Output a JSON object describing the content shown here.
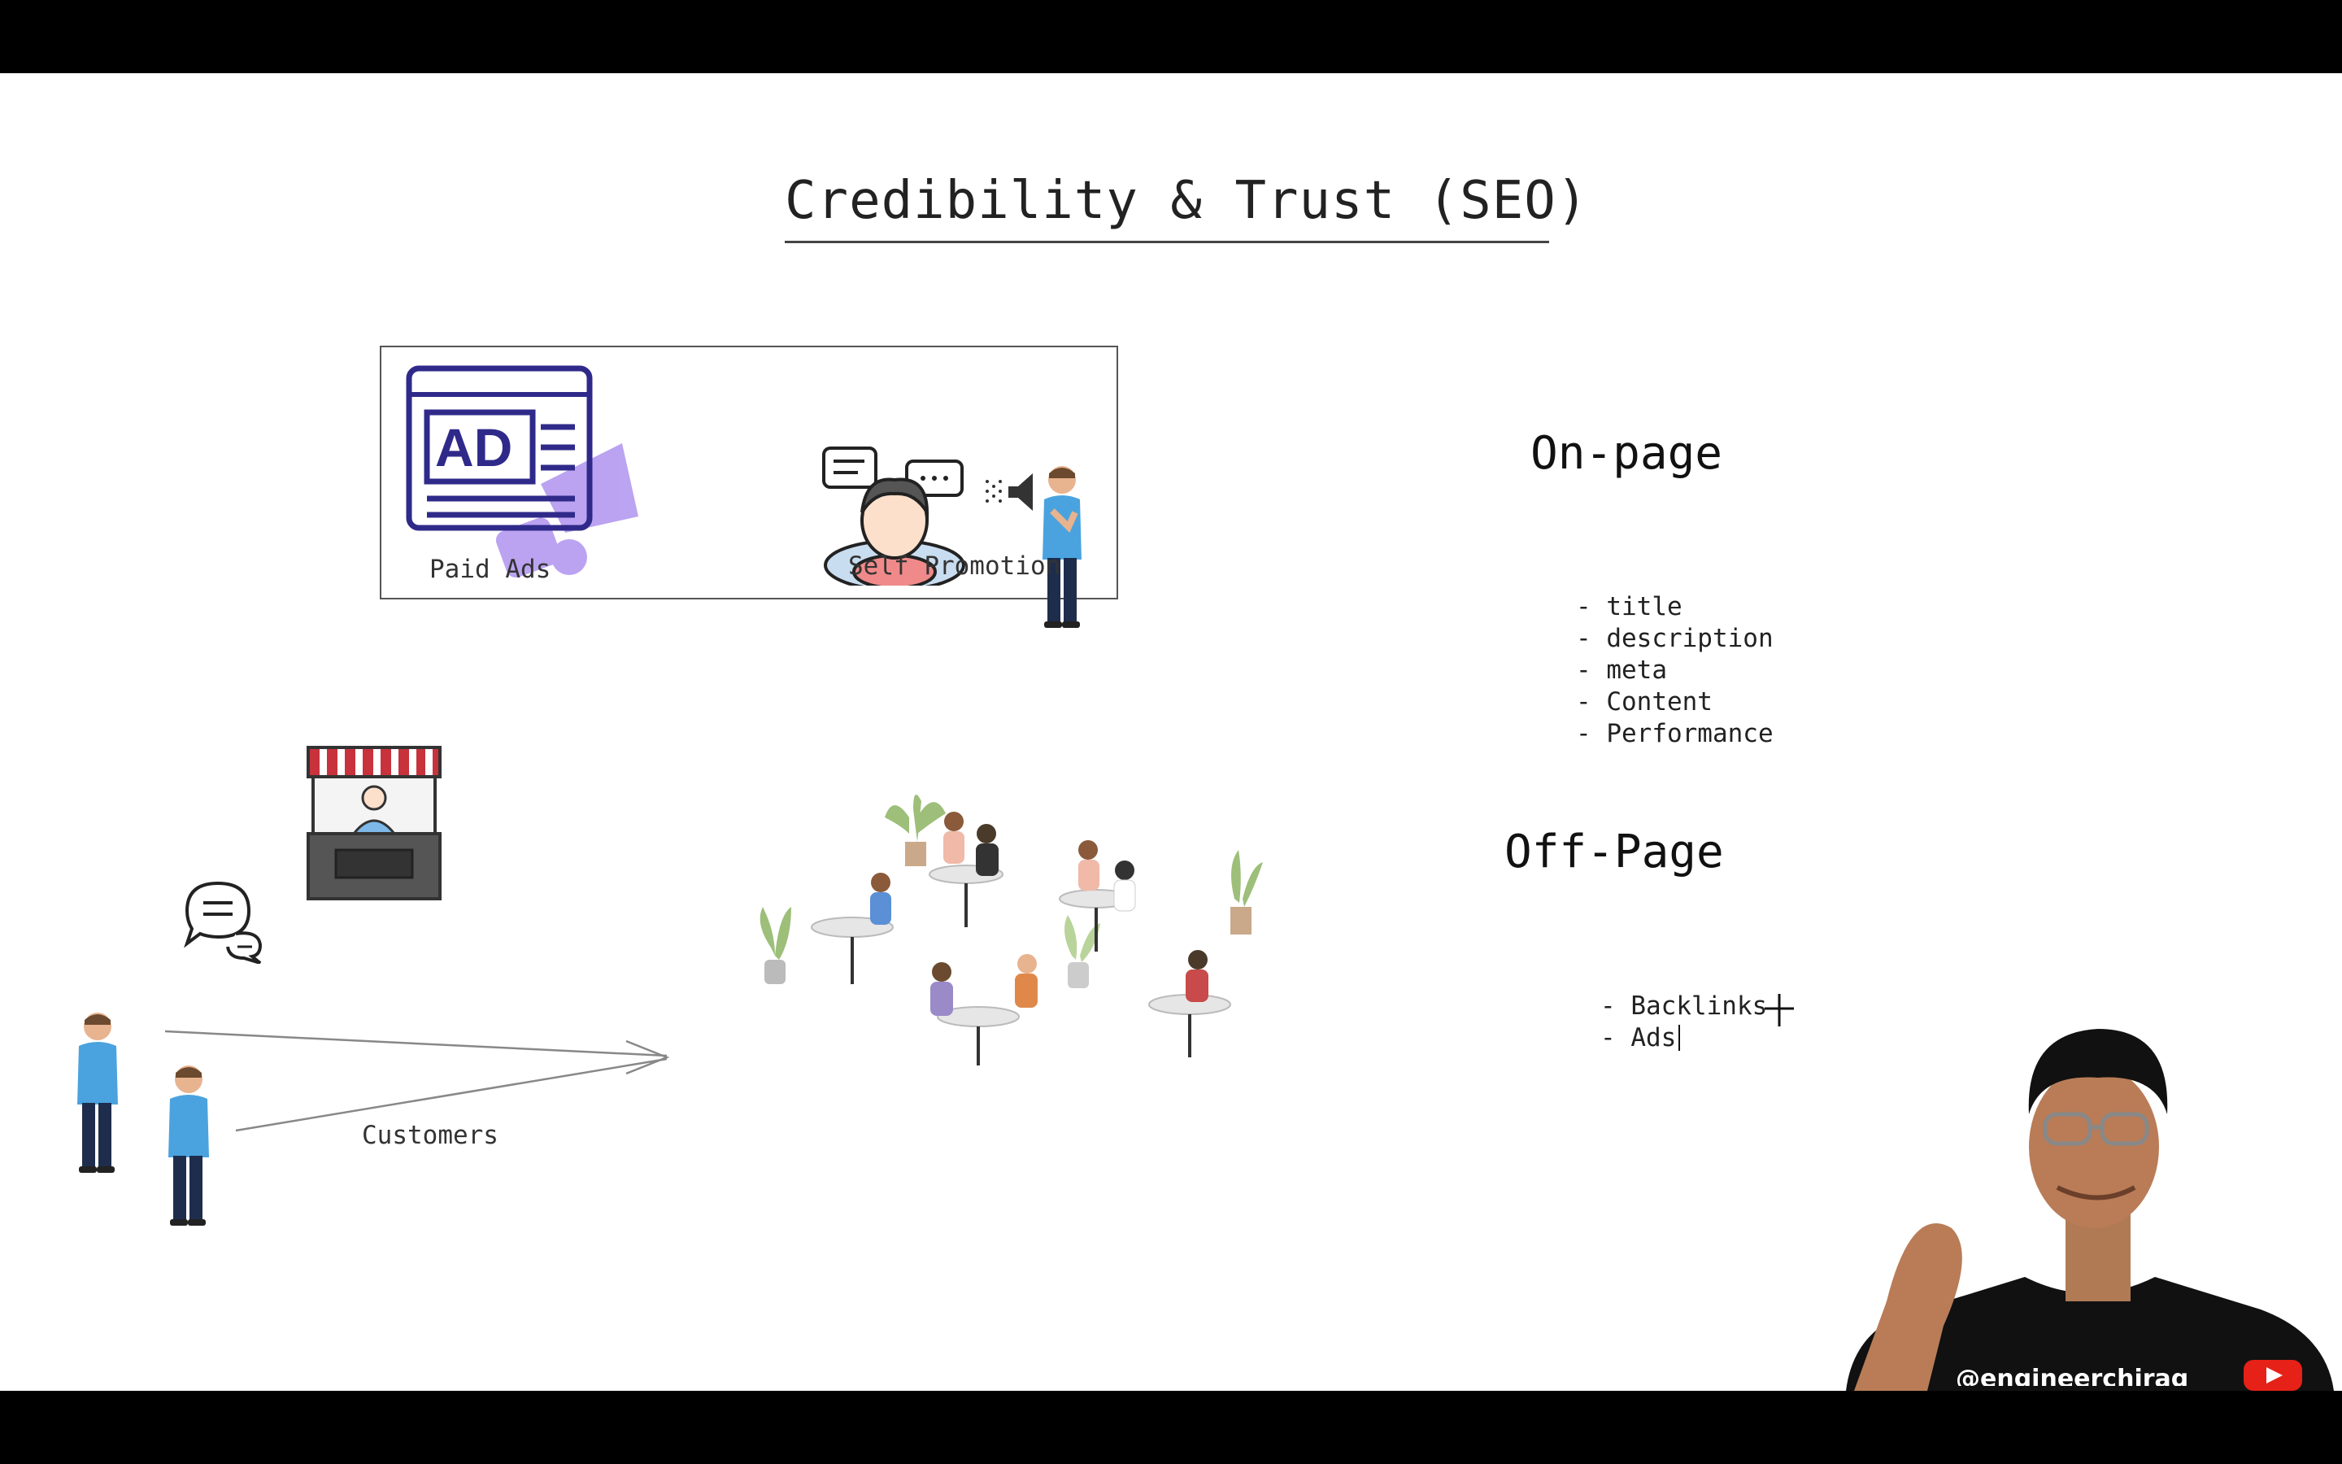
{
  "slide": {
    "title": "Credibility & Trust (SEO)"
  },
  "promo_box": {
    "paid_ads_label": "Paid Ads",
    "self_promotion_label": "Self Promotion",
    "ad_badge_text": "AD"
  },
  "customers_label": "Customers",
  "on_page": {
    "heading": "On-page",
    "items": [
      "- title",
      "- description",
      "- meta",
      "- Content",
      "- Performance"
    ]
  },
  "off_page": {
    "heading": "Off-Page",
    "items": [
      "- Backlinks",
      "- Ads"
    ]
  },
  "presenter": {
    "shirt_text": "@engineerchirag"
  },
  "colors": {
    "ad_icon": "#2f2a8a",
    "megaphone": "#b49af0",
    "shirt": "#4aa3df",
    "youtube": "#e62117"
  }
}
